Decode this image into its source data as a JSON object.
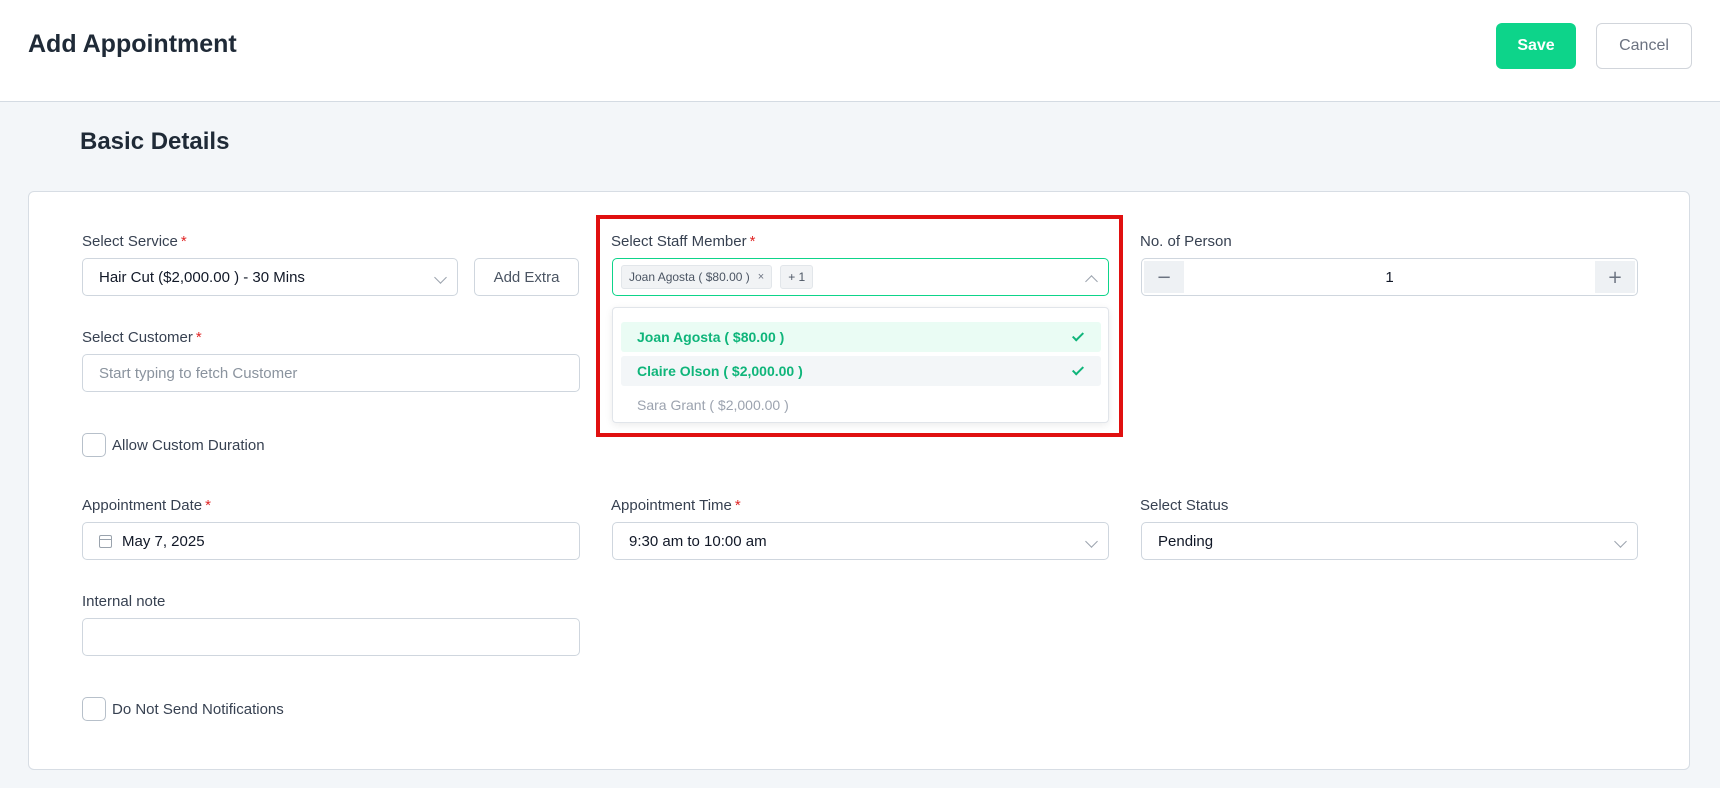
{
  "header": {
    "title": "Add Appointment",
    "save_label": "Save",
    "cancel_label": "Cancel"
  },
  "section": {
    "title": "Basic Details"
  },
  "form": {
    "service": {
      "label": "Select Service",
      "required_mark": "*",
      "value": "Hair Cut ($2,000.00 ) - 30 Mins",
      "add_extra_label": "Add Extra"
    },
    "staff": {
      "label": "Select Staff Member",
      "required_mark": "*",
      "tags": [
        {
          "text": "Joan Agosta ( $80.00 )",
          "remove": "×"
        },
        {
          "text": "+ 1"
        }
      ],
      "options": [
        {
          "label": "Joan Agosta ( $80.00 )",
          "selected": true
        },
        {
          "label": "Claire Olson ( $2,000.00 )",
          "selected": true
        },
        {
          "label": "Sara Grant ( $2,000.00 )",
          "selected": false
        }
      ]
    },
    "persons": {
      "label": "No. of Person",
      "value": "1",
      "minus": "−",
      "plus": "+"
    },
    "customer": {
      "label": "Select Customer",
      "required_mark": "*",
      "placeholder": "Start typing to fetch Customer"
    },
    "custom_duration": {
      "label": "Allow Custom Duration",
      "checked": false
    },
    "date": {
      "label": "Appointment Date",
      "required_mark": "*",
      "value": "May 7, 2025"
    },
    "time": {
      "label": "Appointment Time",
      "required_mark": "*",
      "value": "9:30 am to 10:00 am"
    },
    "status": {
      "label": "Select Status",
      "value": "Pending"
    },
    "note": {
      "label": "Internal note",
      "value": ""
    },
    "notifications": {
      "label": "Do Not Send Notifications",
      "checked": false
    }
  },
  "colors": {
    "accent": "#0dd48a",
    "highlight_border": "#e01010",
    "required": "#e02424"
  }
}
